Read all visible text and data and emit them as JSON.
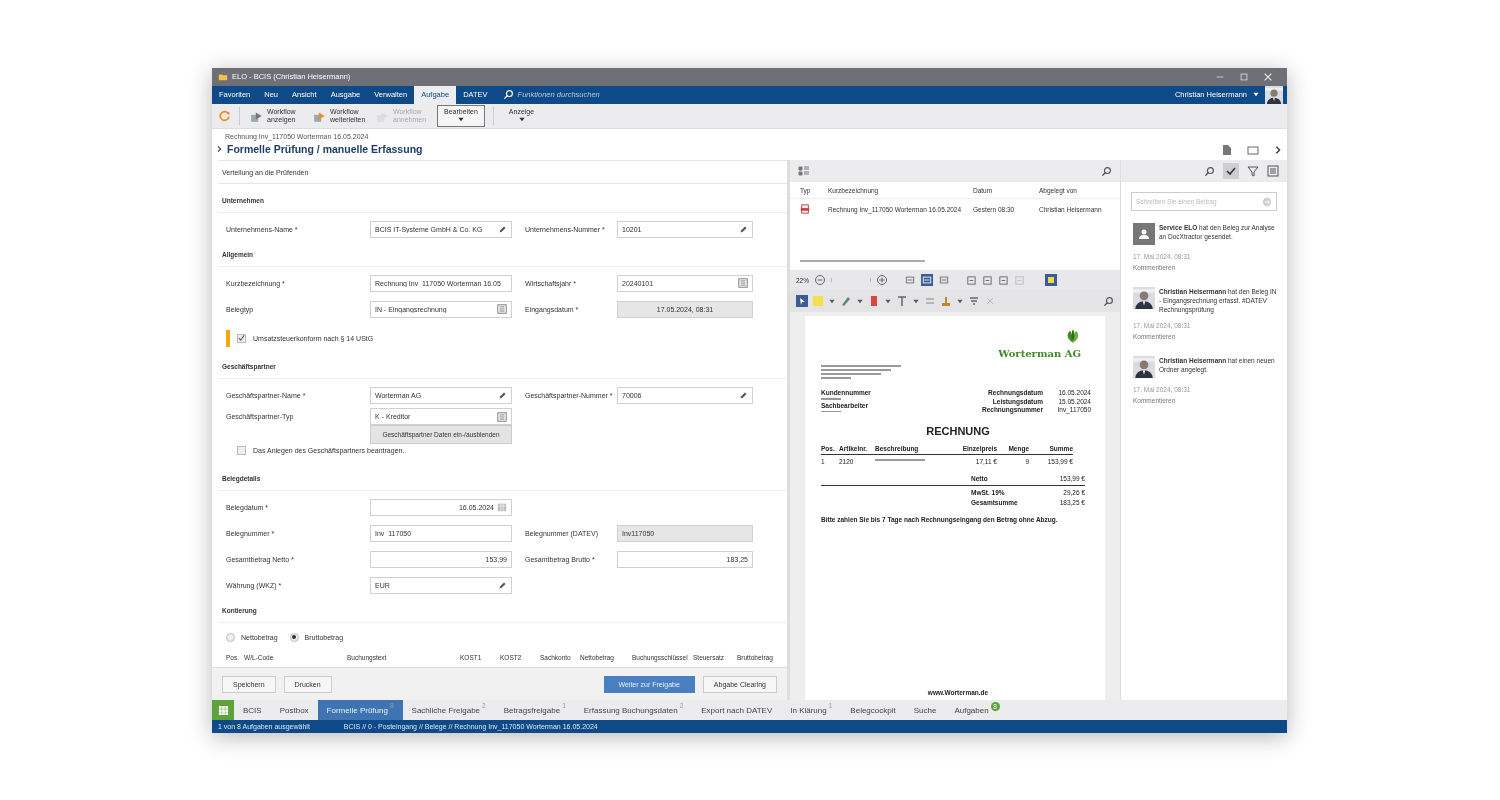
{
  "window": {
    "title": "ELO - BCIS (Christian Heisermann)"
  },
  "menu": {
    "tabs": [
      {
        "label": "Favoriten",
        "selected": false
      },
      {
        "label": "Neu",
        "selected": false
      },
      {
        "label": "Ansicht",
        "selected": false
      },
      {
        "label": "Ausgabe",
        "selected": false
      },
      {
        "label": "Verwalten",
        "selected": false
      },
      {
        "label": "Aufgabe",
        "selected": true
      },
      {
        "label": "DATEV",
        "selected": false
      }
    ],
    "search": {
      "placeholder": "Funktionen durchsuchen"
    },
    "user": "Christian Heisermann"
  },
  "ribbon": [
    {
      "kind": "action",
      "label": "Workflow anzeigen",
      "disabled": false
    },
    {
      "kind": "action",
      "label": "Workflow weiterleiten",
      "disabled": false
    },
    {
      "kind": "action",
      "label": "Workflow annehmen",
      "disabled": true
    },
    {
      "kind": "dropdown",
      "label": "Bearbeiten",
      "selected": true
    },
    {
      "kind": "dropdown",
      "label": "Anzeige",
      "selected": false
    }
  ],
  "header": {
    "breadcrumb": "Rechnung Inv_117050 Worterman 16.05.2024",
    "title": "Formelle Prüfung / manuelle Erfassung"
  },
  "form": {
    "heading": "Verteilung an die Prüfenden",
    "items": [
      {
        "kind": "section",
        "label": "Unternehmen"
      },
      {
        "kind": "row",
        "fields": [
          {
            "label": "Unternehmens-Name *",
            "value": "BCIS IT-Systeme GmbH & Co. KG",
            "kind": "edit"
          },
          {
            "label": "Unternehmens-Nummer *",
            "value": "10201",
            "kind": "edit"
          }
        ]
      },
      {
        "kind": "section",
        "label": "Allgemein"
      },
      {
        "kind": "row",
        "fields": [
          {
            "label": "Kurzbezeichnung *",
            "value": "Rechnung Inv_117050 Worterman 16.05",
            "kind": "text"
          },
          {
            "label": "Wirtschaftsjahr *",
            "value": "20240101",
            "kind": "list"
          }
        ]
      },
      {
        "kind": "row",
        "fields": [
          {
            "label": "Belegtyp",
            "value": "IN - Eingangsrechnung",
            "kind": "list"
          },
          {
            "label": "Eingangsdatum *",
            "value": "17.05.2024, 08:31",
            "kind": "readonly-center"
          }
        ]
      },
      {
        "kind": "check",
        "label": "Umsatzsteuerkonform nach § 14 UStG",
        "checked": true,
        "flagged": true
      },
      {
        "kind": "section",
        "label": "Geschäftspartner"
      },
      {
        "kind": "row",
        "fields": [
          {
            "label": "Geschäftspartner-Name *",
            "value": "Worterman AG",
            "kind": "edit"
          },
          {
            "label": "Geschäftspartner-Nummer *",
            "value": "70006",
            "kind": "edit"
          }
        ]
      },
      {
        "kind": "row",
        "fields": [
          {
            "label": "Geschäftspartner-Typ",
            "value": "K - Kreditor",
            "kind": "list"
          },
          {
            "value": "Geschäftspartner Daten ein-/ausblenden",
            "kind": "button"
          }
        ]
      },
      {
        "kind": "check",
        "label": "Das Anlegen des Geschäftspartners beantragen.",
        "checked": false,
        "flagged": false
      },
      {
        "kind": "section",
        "label": "Belegdetails"
      },
      {
        "kind": "row",
        "fields": [
          {
            "label": "Belegdatum *",
            "value": "16.05.2024",
            "kind": "date"
          }
        ]
      },
      {
        "kind": "row",
        "fields": [
          {
            "label": "Belegnummer *",
            "value": "Inv_117050",
            "kind": "text"
          },
          {
            "label": "Belegnummer (DATEV)",
            "value": "Inv117050",
            "kind": "readonly"
          }
        ]
      },
      {
        "kind": "row",
        "fields": [
          {
            "label": "Gesamtbetrag Netto *",
            "value": "153,99",
            "kind": "number"
          },
          {
            "label": "Gesamtbetrag Brutto *",
            "value": "183,25",
            "kind": "number"
          }
        ]
      },
      {
        "kind": "row",
        "fields": [
          {
            "label": "Währung (WKZ) *",
            "value": "EUR",
            "kind": "edit"
          }
        ]
      },
      {
        "kind": "section",
        "label": "Kontierung"
      },
      {
        "kind": "radio",
        "options": [
          {
            "label": "Nettobetrag",
            "selected": false
          },
          {
            "label": "Bruttobetrag",
            "selected": true
          }
        ]
      },
      {
        "kind": "table",
        "columns": [
          "Pos.",
          "W/L-Code",
          "Buchungstext",
          "KOST1",
          "KOST2",
          "Sachkonto",
          "Nettobetrag",
          "Buchungsschlüssel",
          "Steuersatz",
          "Bruttobetrag"
        ]
      }
    ],
    "buttons_left": [
      {
        "label": "Speichern",
        "primary": false
      },
      {
        "label": "Drucken",
        "primary": false
      }
    ],
    "buttons_right": [
      {
        "label": "Weiter zur Freigabe",
        "primary": true
      },
      {
        "label": "Abgabe Clearing",
        "primary": false
      }
    ]
  },
  "viewer": {
    "columns": [
      "Typ",
      "Kurzbezeichnung",
      "Datum",
      "Abgelegt von"
    ],
    "rows": [
      {
        "name": "Rechnung Inv_117050 Worterman 16.05.2024",
        "date": "Gestern 08:30",
        "by": "Christian Heisermann"
      }
    ],
    "zoom": "22%",
    "view_modes": [
      {
        "selected": false
      },
      {
        "selected": true
      },
      {
        "selected": false
      }
    ],
    "document": {
      "company": "Worterman AG",
      "title": "RECHNUNG",
      "info_left": [
        "Kundennummer",
        "Sachbearbeiter"
      ],
      "info_right": [
        {
          "label": "Rechnungsdatum",
          "value": "16.05.2024"
        },
        {
          "label": "Leistungsdatum",
          "value": "15.05.2024"
        },
        {
          "label": "Rechnungsnummer",
          "value": "Inv_117050"
        }
      ],
      "columns": [
        "Pos.",
        "Artikelnr.",
        "Beschreibung",
        "Einzelpreis",
        "Menge",
        "Summe"
      ],
      "rows": [
        [
          "1",
          "2120",
          "",
          "17,11 €",
          "9",
          "153,99 €"
        ]
      ],
      "totals": [
        {
          "label": "Netto",
          "value": "153,99 €"
        },
        {
          "label": "MwSt. 19%",
          "value": "29,26 €"
        },
        {
          "label": "Gesamtsumme",
          "value": "183,25 €"
        }
      ],
      "note": "Bitte zahlen Sie bis 7 Tage nach Rechnungseingang den Betrag ohne Abzug.",
      "footer": "www.Worterman.de"
    }
  },
  "feed": {
    "placeholder": "Schreiben Sie einen Beitrag",
    "entries": [
      {
        "kind": "generic",
        "text": "**Service ELO** hat den Beleg zur Analyse an DocXtractor gesendet.",
        "date": "17. Mai 2024, 08:31",
        "action": "Kommentieren"
      },
      {
        "kind": "photo",
        "text": "**Christian Heisermann** hat den Beleg IN - Eingangsrechnung erfasst. #DATEV Rechnungsprüfung",
        "date": "17. Mai 2024, 08:31",
        "action": "Kommentieren"
      },
      {
        "kind": "photo",
        "text": "**Christian Heisermann** hat einen neuen Ordner angelegt.",
        "date": "17. Mai 2024, 08:31",
        "action": "Kommentieren"
      }
    ]
  },
  "tabs": [
    {
      "label": "BCIS",
      "selected": false
    },
    {
      "label": "Postbox",
      "selected": false
    },
    {
      "label": "Formelle Prüfung",
      "badge": "8",
      "selected": true
    },
    {
      "label": "Sachliche Freigabe",
      "badge": "2",
      "selected": false
    },
    {
      "label": "Betragsfreigabe",
      "badge": "1",
      "selected": false
    },
    {
      "label": "Erfassung Buchungsdaten",
      "badge": "2",
      "selected": false
    },
    {
      "label": "Export nach DATEV",
      "selected": false
    },
    {
      "label": "In Klärung",
      "badge": "1",
      "selected": false
    },
    {
      "label": "Belegcockpit",
      "selected": false
    },
    {
      "label": "Suche",
      "selected": false
    },
    {
      "label": "Aufgaben",
      "badge": "8",
      "color": "#5ca33b",
      "selected": false
    }
  ],
  "status": {
    "selection": "1 von 8 Aufgaben ausgewählt",
    "path": "BCIS // 0 - Posteingang // Belege // Rechnung Inv_117050 Worterman 16.05.2024"
  }
}
